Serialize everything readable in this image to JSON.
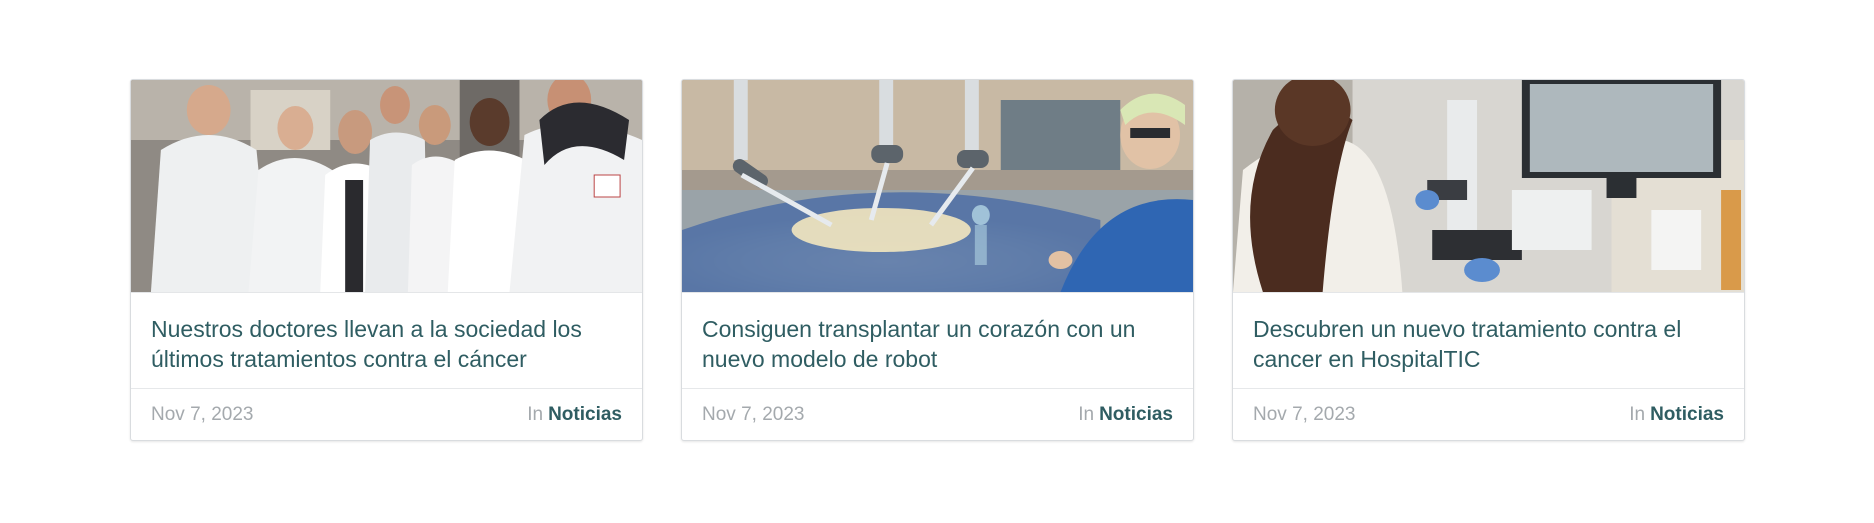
{
  "cards": [
    {
      "image_alt": "Grupo de doctores con batas blancas",
      "title": "Nuestros doctores llevan a la sociedad los últimos tratamientos contra el cáncer",
      "date": "Nov 7, 2023",
      "in_label": "In",
      "category": "Noticias"
    },
    {
      "image_alt": "Cirugía asistida por robot",
      "title": "Consiguen transplantar un corazón con un nuevo modelo de robot",
      "date": "Nov 7, 2023",
      "in_label": "In",
      "category": "Noticias"
    },
    {
      "image_alt": "Investigadora con microscopio en laboratorio",
      "title": "Descubren un nuevo tratamiento contra el cancer en HospitalTIC",
      "date": "Nov 7, 2023",
      "in_label": "In",
      "category": "Noticias"
    }
  ],
  "colors": {
    "title": "#2f5d62",
    "meta": "#a4a9ad",
    "border": "#d9dcdf"
  }
}
